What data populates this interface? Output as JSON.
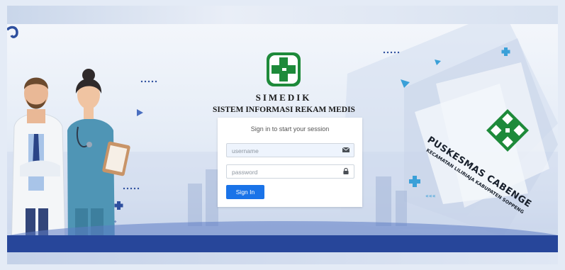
{
  "brand": {
    "app_name": "SIMEDIK",
    "app_subtitle": "SISTEM INFORMASI REKAM MEDIS"
  },
  "login": {
    "message": "Sign in to start your session",
    "username_placeholder": "username",
    "password_placeholder": "password",
    "signin_label": "Sign In"
  },
  "poster": {
    "title": "PUSKESMAS CABENGE",
    "subtitle": "KECAMATAN LILIRIAJA KABUPATEN SOPPENG"
  },
  "colors": {
    "primary_button": "#1a73e8",
    "logo_green": "#1e8a3a",
    "wave_blue": "#27469a"
  },
  "icons": {
    "username_field": "envelope-icon",
    "password_field": "lock-icon"
  }
}
